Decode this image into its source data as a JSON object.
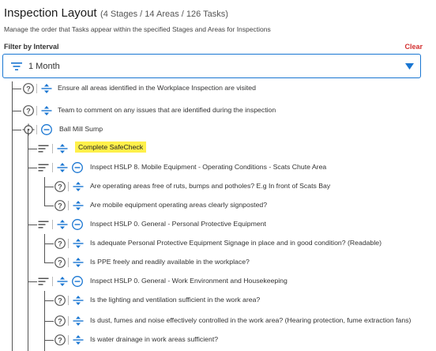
{
  "header": {
    "title": "Inspection Layout",
    "counts": "(4 Stages / 14 Areas / 126 Tasks)",
    "subtitle": "Manage the order that Tasks appear within the specified Stages and Areas for Inspections"
  },
  "filter": {
    "label": "Filter by Interval",
    "clear_label": "Clear",
    "value": "1 Month"
  },
  "colors": {
    "accent": "#1976d2",
    "clear": "#d32f2f",
    "highlight": "#fff04a"
  },
  "tree": {
    "rows": [
      {
        "label": "Ensure all areas identified in the Workplace Inspection are visited"
      },
      {
        "label": "Team to comment on any issues that are identified during the inspection"
      },
      {
        "label": "Ball Mill Sump"
      },
      {
        "label": "Complete SafeCheck"
      },
      {
        "label": "Inspect HSLP 8. Mobile Equipment - Operating Conditions - Scats Chute Area"
      },
      {
        "label": "Are operating areas free of ruts, bumps and potholes? E.g In front of Scats Bay"
      },
      {
        "label": "Are mobile equipment operating areas clearly signposted?"
      },
      {
        "label": "Inspect HSLP 0. General - Personal Protective Equipment"
      },
      {
        "label": "Is adequate Personal Protective Equipment Signage in place and in good condition? (Readable)"
      },
      {
        "label": "Is PPE freely and readily available in the workplace?"
      },
      {
        "label": "Inspect HSLP 0. General - Work Environment and Housekeeping"
      },
      {
        "label": "Is the lighting and ventilation sufficient in the work area?"
      },
      {
        "label": "Is dust, fumes and noise effectively controlled in the work area? (Hearing protection, fume extraction fans)"
      },
      {
        "label": "Is water drainage in work areas sufficient?"
      }
    ]
  }
}
